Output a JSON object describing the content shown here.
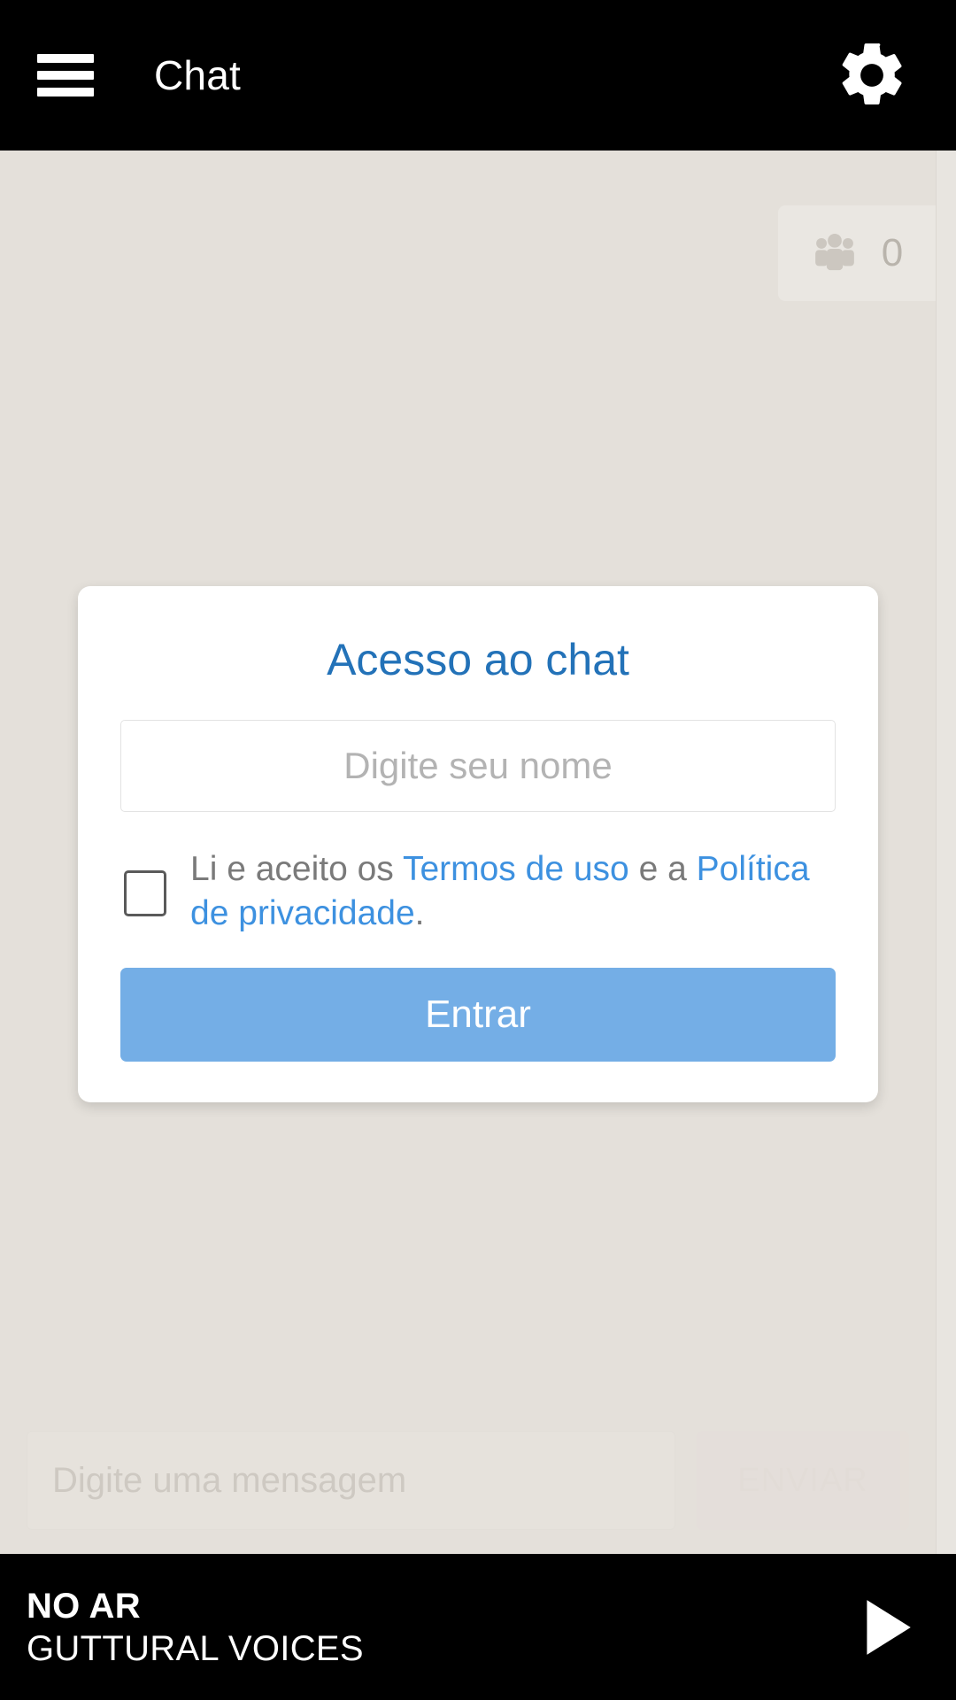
{
  "appbar": {
    "menu_icon": "hamburger-menu-icon",
    "title": "Chat",
    "settings_icon": "gear-icon"
  },
  "chat": {
    "users_icon": "users-group-icon",
    "users_count": "0",
    "composer": {
      "placeholder": "Digite uma mensagem",
      "value": "",
      "send_label": "ENVIAR"
    }
  },
  "login": {
    "title": "Acesso ao chat",
    "name_placeholder": "Digite seu nome",
    "name_value": "",
    "terms": {
      "prefix": "Li e aceito os ",
      "terms_link": "Termos de uso",
      "middle": " e a ",
      "privacy_link": "Política de privacidade",
      "suffix": "."
    },
    "submit_label": "Entrar",
    "checkbox_checked": false
  },
  "player": {
    "status": "NO AR",
    "track": "GUTTURAL VOICES",
    "play_icon": "play-icon"
  },
  "colors": {
    "appbar_bg": "#000000",
    "page_bg": "#e4e0da",
    "card_bg": "#ffffff",
    "title_blue": "#2372b8",
    "link_blue": "#3d91e0",
    "button_blue": "#74aee6",
    "placeholder_gray": "#b3b3b3",
    "player_bg": "#000000"
  }
}
